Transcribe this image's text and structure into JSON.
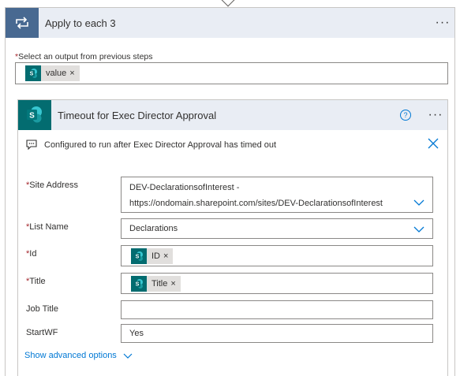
{
  "loop": {
    "title": "Apply to each 3",
    "more_label": "···"
  },
  "select_output": {
    "required_mark": "*",
    "label": "Select an output from previous steps",
    "token": {
      "label": "value",
      "remove": "×"
    }
  },
  "action": {
    "title": "Timeout for Exec Director Approval",
    "help_label": "?",
    "more_label": "···",
    "config_note": "Configured to run after Exec Director Approval has timed out",
    "fields": {
      "site_address": {
        "label": "Site Address",
        "required": "*",
        "value_line1": "DEV-DeclarationsofInterest -",
        "value_line2": "https://ondomain.sharepoint.com/sites/DEV-DeclarationsofInterest"
      },
      "list_name": {
        "label": "List Name",
        "required": "*",
        "value": "Declarations"
      },
      "id": {
        "label": "Id",
        "required": "*",
        "token": "ID",
        "remove": "×"
      },
      "title": {
        "label": "Title",
        "required": "*",
        "token": "Title",
        "remove": "×"
      },
      "job_title": {
        "label": "Job Title",
        "value": ""
      },
      "startwf": {
        "label": "StartWF",
        "value": "Yes"
      }
    },
    "advanced_label": "Show advanced options"
  },
  "colors": {
    "loop_icon_bg": "#486991",
    "header_bg": "#e9edf4",
    "sharepoint": "#036c70",
    "link": "#0078d4",
    "required": "#a4262c"
  }
}
